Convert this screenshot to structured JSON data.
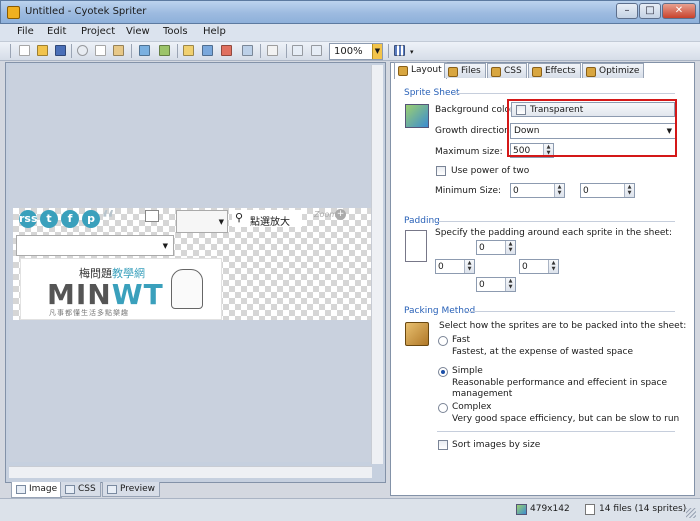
{
  "window": {
    "title": "Untitled - Cyotek Spriter",
    "minimize": "–",
    "maximize": "□",
    "close": "✕"
  },
  "menu": [
    "File",
    "Edit",
    "Project",
    "View",
    "Tools",
    "Help"
  ],
  "toolbar": {
    "zoom": "100%"
  },
  "preview": {
    "social_icons": [
      "rss",
      "t",
      "f",
      "p"
    ],
    "zoom_big_label": "點選放大",
    "zoom_gray_label": "Zoom",
    "logo_cn_top_a": "梅問題",
    "logo_cn_top_b": "教學網",
    "logo_big_a": "MIN",
    "logo_big_b": "WT",
    "logo_cn_bottom": "凡事都懂生活多點樂趣"
  },
  "bottom_tabs": [
    "Image",
    "CSS",
    "Preview"
  ],
  "right_tabs": [
    "Layout",
    "Files",
    "CSS",
    "Effects",
    "Optimize"
  ],
  "sprite_sheet": {
    "heading": "Sprite Sheet",
    "bg_color_label": "Background color:",
    "bg_color_value": "Transparent",
    "growth_label": "Growth direction:",
    "growth_value": "Down",
    "max_size_label": "Maximum size:",
    "max_size_value": "500",
    "power_of_two_label": "Use power of two",
    "min_size_label": "Minimum Size:",
    "min_w": "0",
    "min_h": "0"
  },
  "padding": {
    "heading": "Padding",
    "desc": "Specify the padding around each sprite in the sheet:",
    "top": "0",
    "left": "0",
    "right": "0",
    "bottom": "0"
  },
  "packing": {
    "heading": "Packing Method",
    "desc": "Select how the sprites are to be packed into the sheet:",
    "options": [
      {
        "label": "Fast",
        "desc": "Fastest, at the expense of wasted space",
        "desc2": ""
      },
      {
        "label": "Simple",
        "desc": "Reasonable performance and effecient in space",
        "desc2": "management"
      },
      {
        "label": "Complex",
        "desc": "Very good space efficiency, but can be slow to run",
        "desc2": ""
      }
    ],
    "selected_index": 1,
    "sort_label": "Sort images by size"
  },
  "status": {
    "dimensions": "479x142",
    "files": "14 files (14 sprites)"
  },
  "colors": {
    "accent_blue": "#2a62b8",
    "highlight_red": "#d41818",
    "brand_teal": "#3aa0bc"
  }
}
